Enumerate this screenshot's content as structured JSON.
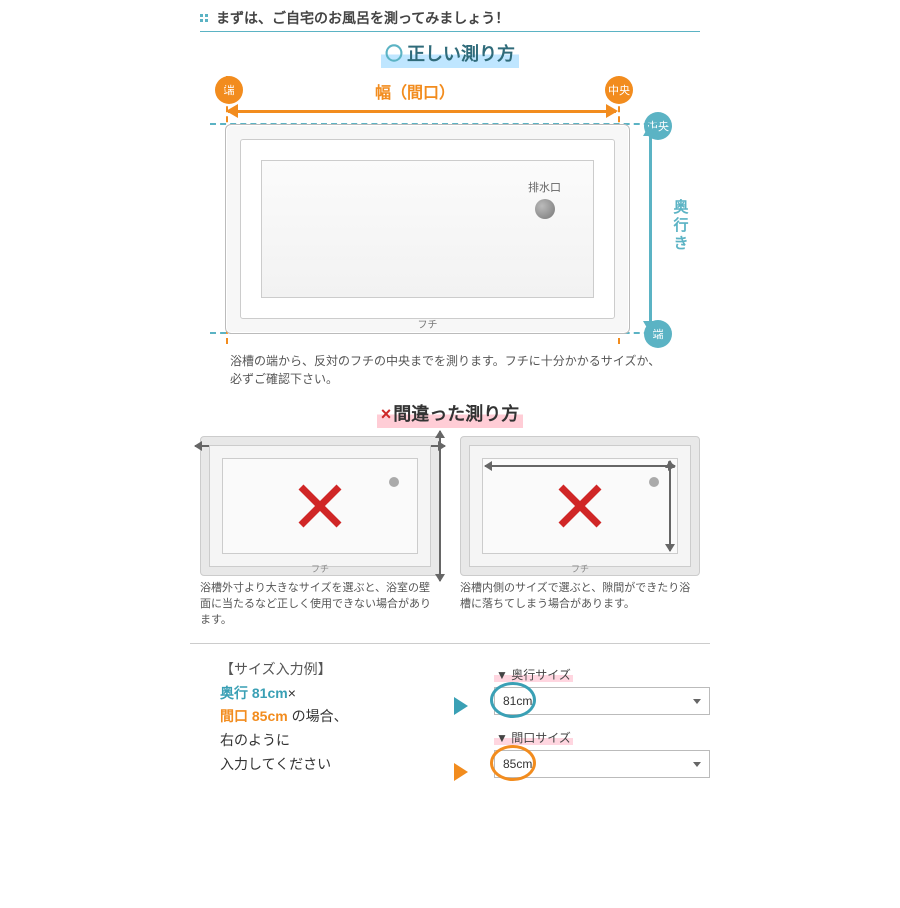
{
  "header": "まずは、ご自宅のお風呂を測ってみましょう！",
  "correct": {
    "title_mark": "〇",
    "title": "正しい測り方",
    "width_label": "幅（間口）",
    "depth_label": "奥行き",
    "badge_edge": "端",
    "badge_center": "中央",
    "drain_label": "排水口",
    "rim_label": "フチ",
    "note": "浴槽の端から、反対のフチの中央までを測ります。フチに十分かかるサイズか、必ずご確認下さい。"
  },
  "wrong": {
    "title_mark": "×",
    "title": "間違った測り方",
    "rim_label": "フチ",
    "note1": "浴槽外寸より大きなサイズを選ぶと、浴室の壁面に当たるなど正しく使用できない場合があります。",
    "note2": "浴槽内側のサイズで選ぶと、隙間ができたり浴槽に落ちてしまう場合があります。"
  },
  "example": {
    "heading": "【サイズ入力例】",
    "depth_label": "奥行",
    "depth_value": "81cm",
    "times": "×",
    "width_label": "間口",
    "width_value": "85cm",
    "text_suffix": "の場合、",
    "text_line3": "右のように",
    "text_line4": "入力してください",
    "select_depth_label": "▼ 奥行サイズ",
    "select_depth_value": "81cm",
    "select_width_label": "▼ 間口サイズ",
    "select_width_value": "85cm"
  }
}
